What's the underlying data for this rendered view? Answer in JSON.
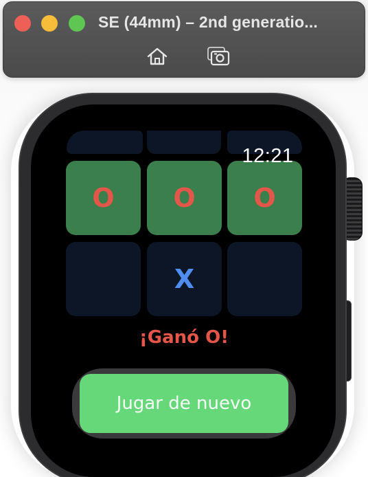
{
  "window": {
    "title": "SE (44mm) – 2nd generatio...",
    "icons": [
      "home-icon",
      "screenshot-icon"
    ]
  },
  "watch": {
    "time": "12:21"
  },
  "board": {
    "rows": [
      [
        "O",
        "O",
        "O"
      ],
      [
        "",
        "X",
        ""
      ]
    ],
    "winning_row": 0
  },
  "game": {
    "status": "¡Ganó O!",
    "play_again_label": "Jugar de nuevo"
  },
  "colors": {
    "win_cell": "#3a7f4c",
    "empty_cell": "#0c1626",
    "o_mark": "#e5564a",
    "x_mark": "#4f8ef0",
    "status_text": "#e5564a",
    "button": "#66d87a"
  }
}
